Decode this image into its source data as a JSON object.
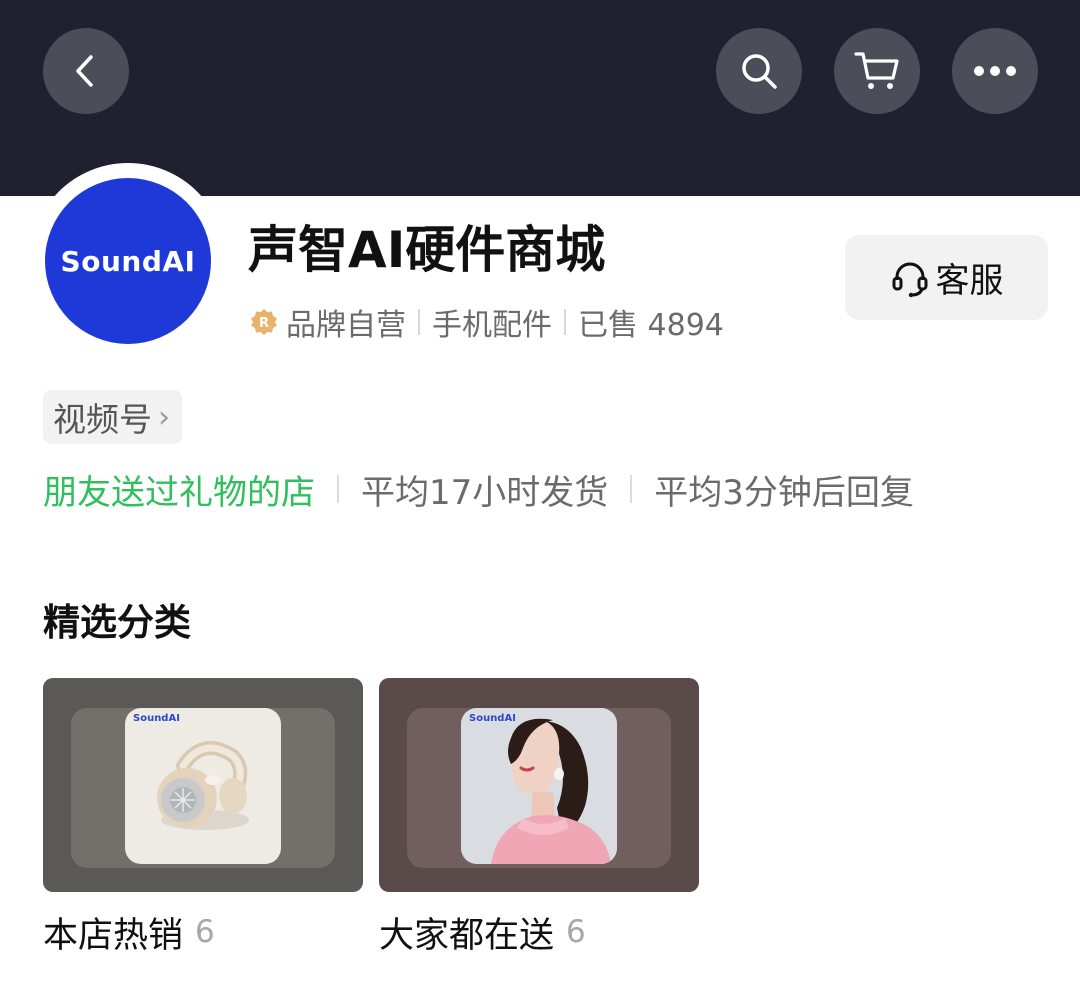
{
  "header": {
    "back_icon": "chevron-left-icon",
    "search_icon": "search-icon",
    "cart_icon": "cart-icon",
    "more_icon": "more-dots-icon"
  },
  "shop": {
    "logo_text": "SoundAI",
    "name": "声智AI硬件商城",
    "badge_icon": "brand-r-badge-icon",
    "brand_label": "品牌自营",
    "category": "手机配件",
    "sold_label": "已售 4894"
  },
  "service_button": {
    "icon": "headset-icon",
    "label": "客服"
  },
  "channel": {
    "label": "视频号",
    "chevron": "›"
  },
  "highlights": {
    "gift": "朋友送过礼物的店",
    "shipping": "平均17小时发货",
    "reply": "平均3分钟后回复"
  },
  "featured": {
    "title": "精选分类",
    "categories": [
      {
        "label": "本店热销",
        "count": "6",
        "thumb_brand": "SoundAI",
        "bg_color": "#5b5955",
        "thumb_bg": "#eeeae4"
      },
      {
        "label": "大家都在送",
        "count": "6",
        "thumb_brand": "SoundAI",
        "bg_color": "#5a4a4a",
        "thumb_bg": "#d9dde2"
      }
    ]
  },
  "colors": {
    "header_bg": "#1f2130",
    "logo_blue": "#1f39d8",
    "green_text": "#2fbf5b"
  }
}
